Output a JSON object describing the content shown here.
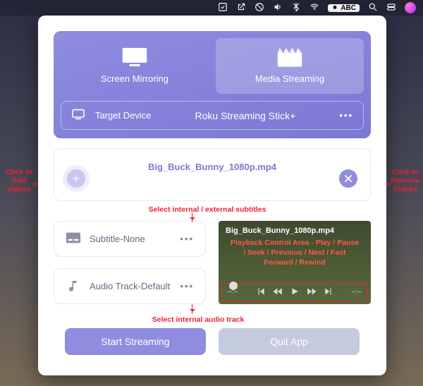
{
  "menubar": {
    "input_label": "ABC"
  },
  "tabs": {
    "screen_mirroring": "Screen Mirroring",
    "media_streaming": "Media Streaming"
  },
  "device": {
    "label": "Target Device",
    "name": "Roku Streaming Stick+"
  },
  "file": {
    "name": "Big_Buck_Bunny_1080p.mp4"
  },
  "annotations": {
    "add_videos": "Click to\nAdd\nVideos",
    "remove_videos": "Click to\nRemove\nVideos",
    "subtitles": "Select internal / external subtitles",
    "audio_track": "Select internal audio track",
    "playback_area": "Playback Control Area - Play / Pause / Seek / Previous / Next / Fast Forward / Rewind"
  },
  "options": {
    "subtitle_label": "Subtitle-None",
    "audio_label": "Audio Track-Default"
  },
  "player": {
    "title": "Big_Buck_Bunny_1080p.mp4",
    "time_left": "--:--",
    "time_right": "--:--"
  },
  "buttons": {
    "start": "Start Streaming",
    "quit": "Quit App"
  }
}
